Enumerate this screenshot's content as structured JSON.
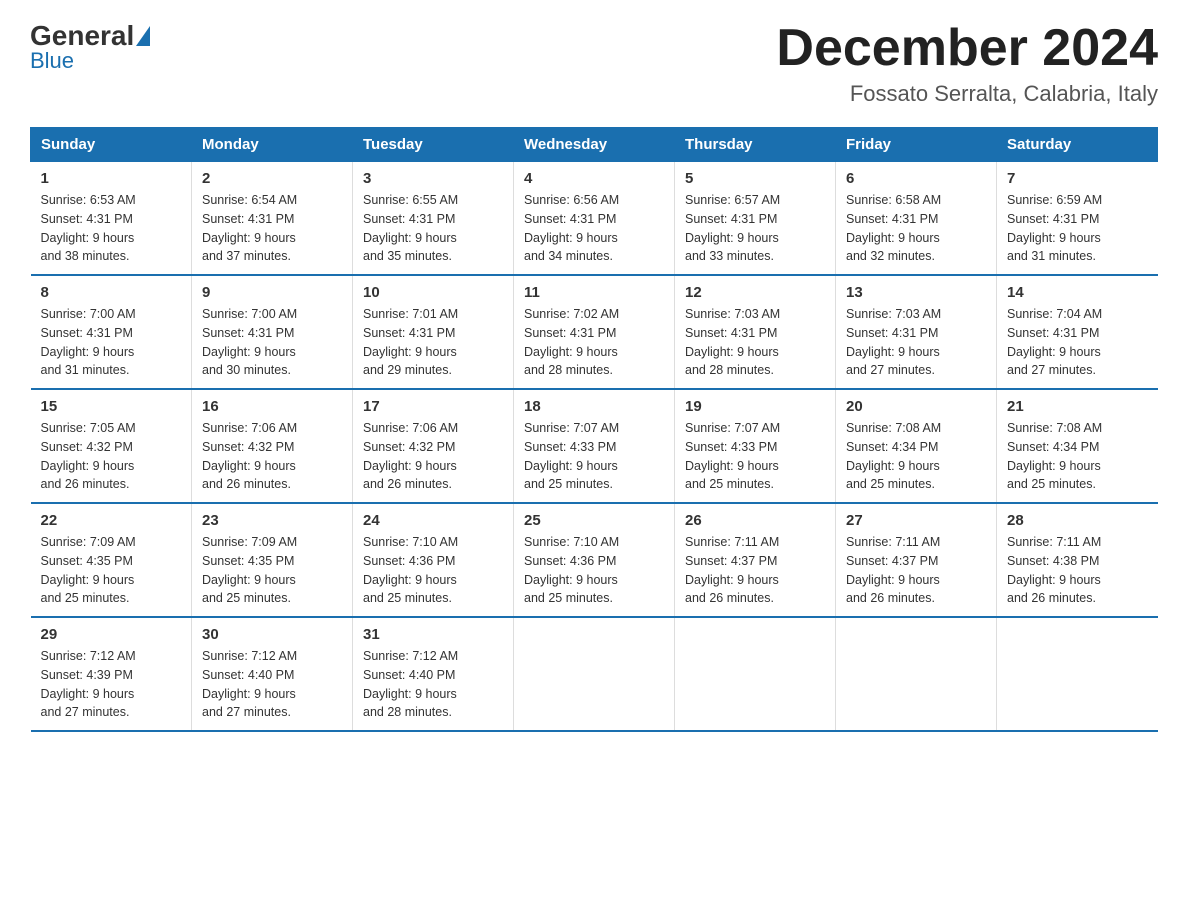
{
  "header": {
    "logo_general": "General",
    "logo_blue": "Blue",
    "month_title": "December 2024",
    "location": "Fossato Serralta, Calabria, Italy"
  },
  "days_of_week": [
    "Sunday",
    "Monday",
    "Tuesday",
    "Wednesday",
    "Thursday",
    "Friday",
    "Saturday"
  ],
  "weeks": [
    [
      {
        "day": "1",
        "info": "Sunrise: 6:53 AM\nSunset: 4:31 PM\nDaylight: 9 hours\nand 38 minutes."
      },
      {
        "day": "2",
        "info": "Sunrise: 6:54 AM\nSunset: 4:31 PM\nDaylight: 9 hours\nand 37 minutes."
      },
      {
        "day": "3",
        "info": "Sunrise: 6:55 AM\nSunset: 4:31 PM\nDaylight: 9 hours\nand 35 minutes."
      },
      {
        "day": "4",
        "info": "Sunrise: 6:56 AM\nSunset: 4:31 PM\nDaylight: 9 hours\nand 34 minutes."
      },
      {
        "day": "5",
        "info": "Sunrise: 6:57 AM\nSunset: 4:31 PM\nDaylight: 9 hours\nand 33 minutes."
      },
      {
        "day": "6",
        "info": "Sunrise: 6:58 AM\nSunset: 4:31 PM\nDaylight: 9 hours\nand 32 minutes."
      },
      {
        "day": "7",
        "info": "Sunrise: 6:59 AM\nSunset: 4:31 PM\nDaylight: 9 hours\nand 31 minutes."
      }
    ],
    [
      {
        "day": "8",
        "info": "Sunrise: 7:00 AM\nSunset: 4:31 PM\nDaylight: 9 hours\nand 31 minutes."
      },
      {
        "day": "9",
        "info": "Sunrise: 7:00 AM\nSunset: 4:31 PM\nDaylight: 9 hours\nand 30 minutes."
      },
      {
        "day": "10",
        "info": "Sunrise: 7:01 AM\nSunset: 4:31 PM\nDaylight: 9 hours\nand 29 minutes."
      },
      {
        "day": "11",
        "info": "Sunrise: 7:02 AM\nSunset: 4:31 PM\nDaylight: 9 hours\nand 28 minutes."
      },
      {
        "day": "12",
        "info": "Sunrise: 7:03 AM\nSunset: 4:31 PM\nDaylight: 9 hours\nand 28 minutes."
      },
      {
        "day": "13",
        "info": "Sunrise: 7:03 AM\nSunset: 4:31 PM\nDaylight: 9 hours\nand 27 minutes."
      },
      {
        "day": "14",
        "info": "Sunrise: 7:04 AM\nSunset: 4:31 PM\nDaylight: 9 hours\nand 27 minutes."
      }
    ],
    [
      {
        "day": "15",
        "info": "Sunrise: 7:05 AM\nSunset: 4:32 PM\nDaylight: 9 hours\nand 26 minutes."
      },
      {
        "day": "16",
        "info": "Sunrise: 7:06 AM\nSunset: 4:32 PM\nDaylight: 9 hours\nand 26 minutes."
      },
      {
        "day": "17",
        "info": "Sunrise: 7:06 AM\nSunset: 4:32 PM\nDaylight: 9 hours\nand 26 minutes."
      },
      {
        "day": "18",
        "info": "Sunrise: 7:07 AM\nSunset: 4:33 PM\nDaylight: 9 hours\nand 25 minutes."
      },
      {
        "day": "19",
        "info": "Sunrise: 7:07 AM\nSunset: 4:33 PM\nDaylight: 9 hours\nand 25 minutes."
      },
      {
        "day": "20",
        "info": "Sunrise: 7:08 AM\nSunset: 4:34 PM\nDaylight: 9 hours\nand 25 minutes."
      },
      {
        "day": "21",
        "info": "Sunrise: 7:08 AM\nSunset: 4:34 PM\nDaylight: 9 hours\nand 25 minutes."
      }
    ],
    [
      {
        "day": "22",
        "info": "Sunrise: 7:09 AM\nSunset: 4:35 PM\nDaylight: 9 hours\nand 25 minutes."
      },
      {
        "day": "23",
        "info": "Sunrise: 7:09 AM\nSunset: 4:35 PM\nDaylight: 9 hours\nand 25 minutes."
      },
      {
        "day": "24",
        "info": "Sunrise: 7:10 AM\nSunset: 4:36 PM\nDaylight: 9 hours\nand 25 minutes."
      },
      {
        "day": "25",
        "info": "Sunrise: 7:10 AM\nSunset: 4:36 PM\nDaylight: 9 hours\nand 25 minutes."
      },
      {
        "day": "26",
        "info": "Sunrise: 7:11 AM\nSunset: 4:37 PM\nDaylight: 9 hours\nand 26 minutes."
      },
      {
        "day": "27",
        "info": "Sunrise: 7:11 AM\nSunset: 4:37 PM\nDaylight: 9 hours\nand 26 minutes."
      },
      {
        "day": "28",
        "info": "Sunrise: 7:11 AM\nSunset: 4:38 PM\nDaylight: 9 hours\nand 26 minutes."
      }
    ],
    [
      {
        "day": "29",
        "info": "Sunrise: 7:12 AM\nSunset: 4:39 PM\nDaylight: 9 hours\nand 27 minutes."
      },
      {
        "day": "30",
        "info": "Sunrise: 7:12 AM\nSunset: 4:40 PM\nDaylight: 9 hours\nand 27 minutes."
      },
      {
        "day": "31",
        "info": "Sunrise: 7:12 AM\nSunset: 4:40 PM\nDaylight: 9 hours\nand 28 minutes."
      },
      {
        "day": "",
        "info": ""
      },
      {
        "day": "",
        "info": ""
      },
      {
        "day": "",
        "info": ""
      },
      {
        "day": "",
        "info": ""
      }
    ]
  ]
}
